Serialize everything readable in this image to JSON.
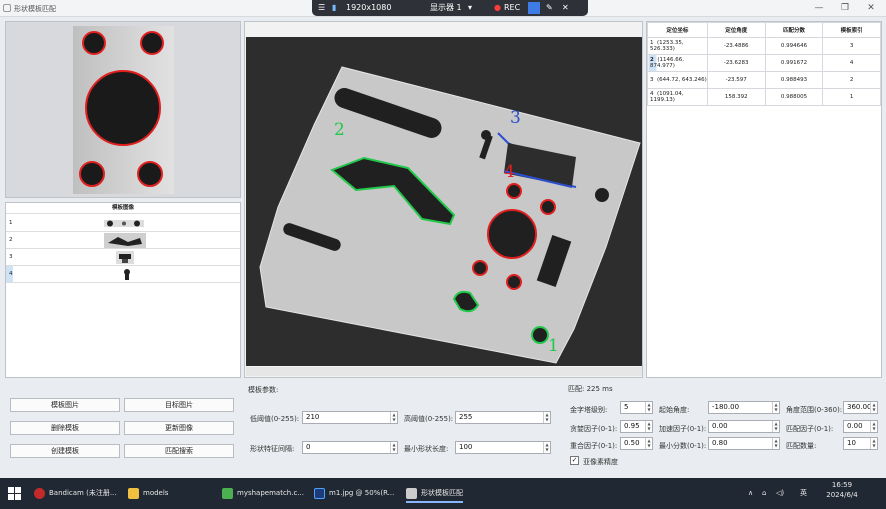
{
  "window": {
    "title": "形状模板匹配",
    "controls": [
      "—",
      "❐",
      "✕"
    ]
  },
  "recorder": {
    "resolution": "1920x1080",
    "display": "显示器 1",
    "rec": "REC"
  },
  "template_table": {
    "header": "模板图像",
    "rows": [
      "1",
      "2",
      "3",
      "4"
    ]
  },
  "match_table": {
    "headers": [
      "定位坐标",
      "定位角度",
      "匹配分数",
      "模板索引"
    ],
    "rows": [
      [
        "1",
        "(1253.35, 526.333)",
        "-23.4886",
        "0.994646",
        "3"
      ],
      [
        "2",
        "(1146.66, 874.977)",
        "-23.6283",
        "0.991672",
        "4"
      ],
      [
        "3",
        "(644.72, 643.246)",
        "-23.597",
        "0.988493",
        "2"
      ],
      [
        "4",
        "(1091.04, 1199.13)",
        "158.392",
        "0.988005",
        "1"
      ]
    ]
  },
  "buttons": {
    "template_image": "模板图片",
    "target_image": "目标图片",
    "delete_template": "删除模板",
    "update_image": "更新图像",
    "create_template": "创建模板",
    "match_search": "匹配搜索"
  },
  "template_params": {
    "title": "模板参数:",
    "low_label": "低阈值(0-255):",
    "low_value": "210",
    "high_label": "高阈值(0-255):",
    "high_value": "255",
    "interval_label": "形状特征间隔:",
    "interval_value": "0",
    "min_len_label": "最小形状长度:",
    "min_len_value": "100"
  },
  "match_params": {
    "title": "匹配: 225 ms",
    "pyramid_label": "金字塔级别:",
    "pyramid_value": "5",
    "start_angle_label": "起始角度:",
    "start_angle_value": "-180.00",
    "angle_range_label": "角度范围(0-360):",
    "angle_range_value": "360.00",
    "greed_label": "贪婪因子(0-1):",
    "greed_value": "0.95",
    "speed_label": "加速因子(0-1):",
    "speed_value": "0.00",
    "match_factor_label": "匹配因子(0-1):",
    "match_factor_value": "0.00",
    "overlap_label": "重合因子(0-1):",
    "overlap_value": "0.50",
    "min_score_label": "最小分数(0-1):",
    "min_score_value": "0.80",
    "count_label": "匹配数量:",
    "count_value": "10",
    "subpixel_label": "亚像素精度",
    "subpixel_checked": "✓"
  },
  "overlay_labels": [
    "1",
    "2",
    "3",
    "4"
  ],
  "taskbar": {
    "items": [
      "Bandicam (未注册...",
      "models",
      "myshapematch.c...",
      "m1.jpg @ 50%(R...",
      "形状模板匹配"
    ],
    "ime": "英",
    "time": "16:59",
    "date": "2024/6/4",
    "tray_up": "∧",
    "network": "⌂",
    "volume": "◁)"
  },
  "colors": {
    "match_red": "#e02020",
    "match_green": "#22c84a",
    "match_blue": "#2b4fd0"
  }
}
